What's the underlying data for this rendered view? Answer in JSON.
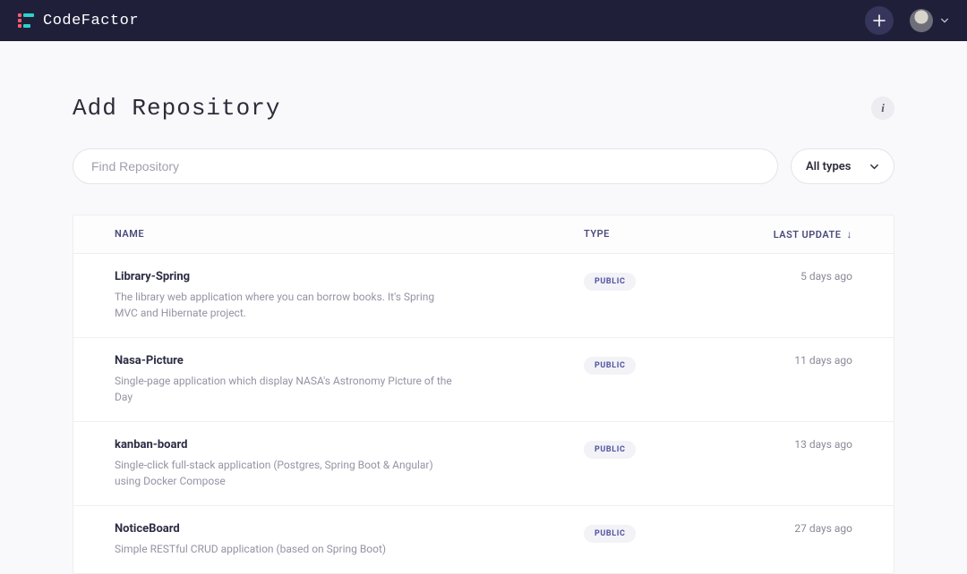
{
  "brand": {
    "name": "CodeFactor",
    "colors": {
      "accent1": "#ff5b6a",
      "accent2": "#2ad4c9"
    }
  },
  "header": {
    "add_label": "+",
    "info_label": "i"
  },
  "page": {
    "title": "Add Repository"
  },
  "search": {
    "placeholder": "Find Repository",
    "value": ""
  },
  "filter": {
    "selected": "All types"
  },
  "table": {
    "columns": {
      "name": "NAME",
      "type": "TYPE",
      "update": "LAST UPDATE"
    },
    "rows": [
      {
        "name": "Library-Spring",
        "description": "The library web application where you can borrow books. It's Spring MVC and Hibernate project.",
        "type": "PUBLIC",
        "updated": "5 days ago"
      },
      {
        "name": "Nasa-Picture",
        "description": "Single-page application which display NASA's Astronomy Picture of the Day",
        "type": "PUBLIC",
        "updated": "11 days ago"
      },
      {
        "name": "kanban-board",
        "description": "Single-click full-stack application (Postgres, Spring Boot & Angular) using Docker Compose",
        "type": "PUBLIC",
        "updated": "13 days ago"
      },
      {
        "name": "NoticeBoard",
        "description": "Simple RESTful CRUD application (based on Spring Boot)",
        "type": "PUBLIC",
        "updated": "27 days ago"
      }
    ]
  }
}
